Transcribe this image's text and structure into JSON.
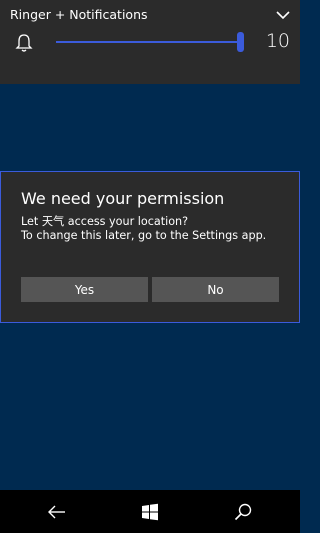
{
  "volume": {
    "title": "Ringer + Notifications",
    "value": "10",
    "level_fraction": 1.0,
    "icons": {
      "mode": "bell-icon",
      "expand": "chevron-down-icon"
    }
  },
  "dialog": {
    "title": "We need your permission",
    "line1": "Let 天气 access your location?",
    "line2": "To change this later, go to the Settings app.",
    "yes_label": "Yes",
    "no_label": "No"
  },
  "navbar": {
    "icons": [
      "back-arrow-icon",
      "windows-start-icon",
      "search-icon"
    ]
  },
  "colors": {
    "accent": "#3b5bdb",
    "background": "#002a50",
    "panel": "#2b2b2b",
    "button": "#555555"
  }
}
